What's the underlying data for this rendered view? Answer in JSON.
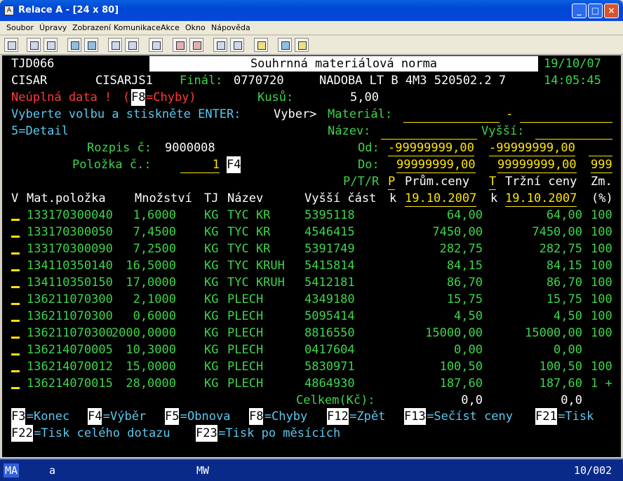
{
  "window": {
    "title": "Relace A - [24 x 80]",
    "icon_label": "A"
  },
  "menu": [
    "Soubor",
    "Úpravy",
    "Zobrazení",
    "Komunikace",
    "Akce",
    "Okno",
    "Nápověda"
  ],
  "screen": {
    "program": "TJD066",
    "header": "Souhrnná materiálová norma",
    "date": "19/10/07",
    "time": "14:05:45",
    "user": "CISAR",
    "job": "CISARJS1",
    "final_label": "Finál:",
    "final_value": "0770720",
    "final_desc": "NADOBA LT B 4M3 520502.2 7",
    "error_text": "Neúplná data !",
    "error_open": "(",
    "error_key": "F8",
    "error_key_text": "=Chyby)",
    "pieces_label": "Kusů:",
    "pieces_value": "5,00",
    "instruction": "Vyberte volbu a stiskněte ENTER:",
    "select_label": "Vyber>",
    "material_label": "Materiál:",
    "material_dash": "-",
    "option_detail": "5=Detail",
    "name_label": "Název:",
    "higher_label": "Vyšší:",
    "rozpis_label": "Rozpis č:",
    "rozpis_value": "9000008",
    "from_label": "Od:",
    "from1": "-99999999,00",
    "from2": "-99999999,00",
    "item_label": "Položka č.:",
    "item_value": "1",
    "item_key": "F4",
    "to_label": "Do:",
    "to1": "99999999,00",
    "to2": "99999999,00",
    "to3": "999",
    "ptr_label": "P/T/R",
    "col_p": "P",
    "col_avg": "Prům.ceny",
    "col_t": "T",
    "col_market": "Tržní ceny",
    "col_zm": "Zm.",
    "col_v": "V",
    "col_item": "Mat.položka",
    "col_qty": "Množství",
    "col_tj": "TJ",
    "col_name": "Název",
    "col_higher": "Vyšší část",
    "col_k1": "k",
    "col_date1": "19.10.2007",
    "col_k2": "k",
    "col_date2": "19.10.2007",
    "col_pct": "(%)",
    "rows": [
      {
        "item": "133170300040",
        "qty": "1,6000",
        "tj": "KG",
        "name": "TYC KR",
        "higher": "5395118",
        "avg": "64,00",
        "market": "64,00",
        "zm": "100"
      },
      {
        "item": "133170300050",
        "qty": "7,4500",
        "tj": "KG",
        "name": "TYC KR",
        "higher": "4546415",
        "avg": "7450,00",
        "market": "7450,00",
        "zm": "100"
      },
      {
        "item": "133170300090",
        "qty": "7,2500",
        "tj": "KG",
        "name": "TYC KR",
        "higher": "5391749",
        "avg": "282,75",
        "market": "282,75",
        "zm": "100"
      },
      {
        "item": "134110350140",
        "qty": "16,5000",
        "tj": "KG",
        "name": "TYC KRUH",
        "higher": "5415814",
        "avg": "84,15",
        "market": "84,15",
        "zm": "100"
      },
      {
        "item": "134110350150",
        "qty": "17,0000",
        "tj": "KG",
        "name": "TYC KRUH",
        "higher": "5412181",
        "avg": "86,70",
        "market": "86,70",
        "zm": "100"
      },
      {
        "item": "136211070300",
        "qty": "2,1000",
        "tj": "KG",
        "name": "PLECH",
        "higher": "4349180",
        "avg": "15,75",
        "market": "15,75",
        "zm": "100"
      },
      {
        "item": "136211070300",
        "qty": "0,6000",
        "tj": "KG",
        "name": "PLECH",
        "higher": "5095414",
        "avg": "4,50",
        "market": "4,50",
        "zm": "100"
      },
      {
        "item": "136211070300",
        "qty": "2000,0000",
        "tj": "KG",
        "name": "PLECH",
        "higher": "8816550",
        "avg": "15000,00",
        "market": "15000,00",
        "zm": "100"
      },
      {
        "item": "136214070005",
        "qty": "10,3000",
        "tj": "KG",
        "name": "PLECH",
        "higher": "0417604",
        "avg": "0,00",
        "market": "0,00",
        "zm": ""
      },
      {
        "item": "136214070012",
        "qty": "15,0000",
        "tj": "KG",
        "name": "PLECH",
        "higher": "5830971",
        "avg": "100,50",
        "market": "100,50",
        "zm": "100"
      },
      {
        "item": "136214070015",
        "qty": "28,0000",
        "tj": "KG",
        "name": "PLECH",
        "higher": "4864930",
        "avg": "187,60",
        "market": "187,60",
        "zm": "1 +"
      }
    ],
    "total_label": "Celkem(Kč):",
    "total_avg": "0,0",
    "total_market": "0,0",
    "fkeys_row1": [
      {
        "key": "F3",
        "text": "=Konec"
      },
      {
        "key": "F4",
        "text": "=Výběr"
      },
      {
        "key": "F5",
        "text": "=Obnova"
      },
      {
        "key": "F8",
        "text": "=Chyby"
      },
      {
        "key": "F12",
        "text": "=Zpět"
      },
      {
        "key": "F13",
        "text": "=Sečíst ceny"
      },
      {
        "key": "F21",
        "text": "=Tisk"
      }
    ],
    "fkeys_row2": [
      {
        "key": "F22",
        "text": "=Tisk celého dotazu"
      },
      {
        "key": "F23",
        "text": "=Tisk po měsících"
      }
    ]
  },
  "status": {
    "mode": "MA",
    "session": "a",
    "mw": "MW",
    "position": "10/002"
  }
}
